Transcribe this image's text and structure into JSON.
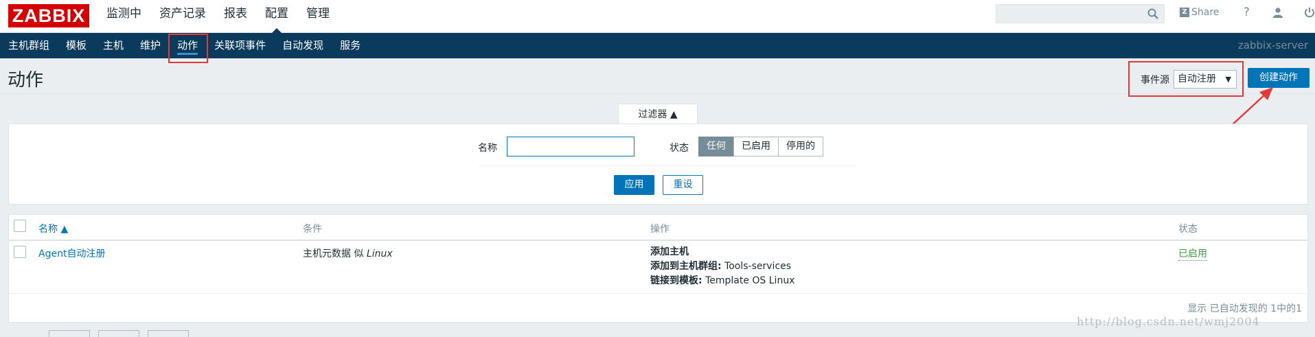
{
  "topbar": {
    "logo": "ZABBIX",
    "menu": [
      "监测中",
      "资产记录",
      "报表",
      "配置",
      "管理"
    ],
    "active_menu": "配置",
    "share_label": "Share",
    "help_icon": "question-icon",
    "user_icon": "user-icon",
    "power_icon": "power-icon"
  },
  "navbar": {
    "items": [
      "主机群组",
      "模板",
      "主机",
      "维护",
      "动作",
      "关联项事件",
      "自动发现",
      "服务"
    ],
    "active": "动作",
    "server": "zabbix-server"
  },
  "page": {
    "title": "动作",
    "event_source_label": "事件源",
    "event_source_value": "自动注册",
    "create_button": "创建动作"
  },
  "filter": {
    "tab_label": "过滤器 ▲",
    "name_label": "名称",
    "name_value": "",
    "state_label": "状态",
    "state_options": [
      "任何",
      "已启用",
      "停用的"
    ],
    "state_selected": "任何",
    "apply_button": "应用",
    "reset_button": "重设"
  },
  "table": {
    "columns": {
      "name": "名称 ▲",
      "conditions": "条件",
      "operations": "操作",
      "status": "状态"
    },
    "rows": [
      {
        "name": "Agent自动注册",
        "condition_text": "主机元数据 似",
        "condition_value": "Linux",
        "operations": [
          {
            "label": "添加主机",
            "value": ""
          },
          {
            "label": "添加到主机群组:",
            "value": "Tools-services"
          },
          {
            "label": "链接到模板:",
            "value": "Template OS Linux"
          }
        ],
        "status": "已启用"
      }
    ],
    "summary": "显示 已自动发现的 1中的1"
  },
  "watermark": "http://blog.csdn.net/wmj2004",
  "colors": {
    "brand_red": "#d40000",
    "nav_bg": "#0b3b5c",
    "primary": "#0275b8",
    "enabled_green": "#429e47",
    "highlight_red": "#e53935"
  }
}
